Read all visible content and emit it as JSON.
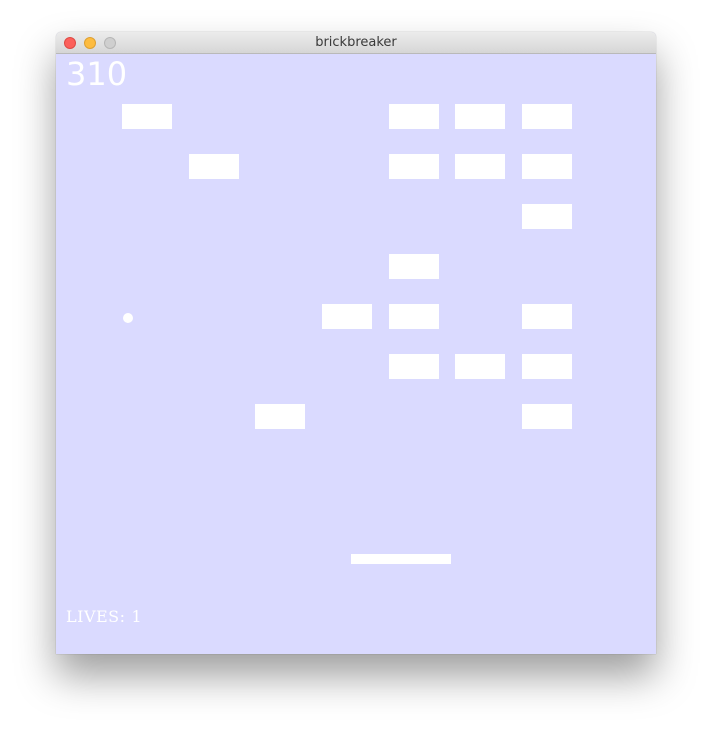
{
  "window": {
    "title": "brickbreaker"
  },
  "hud": {
    "score": "310",
    "lives_label": "LIVES:",
    "lives_value": "1"
  },
  "colors": {
    "playfield_background": "#dadaff",
    "brick": "#ffffff",
    "ball": "#ffffff",
    "paddle": "#ffffff",
    "hud_text": "#ffffff"
  },
  "grid": {
    "columns": 8,
    "rows": 7
  },
  "bricks": [
    {
      "row": 0,
      "col": 0
    },
    {
      "row": 0,
      "col": 4
    },
    {
      "row": 0,
      "col": 5
    },
    {
      "row": 0,
      "col": 6
    },
    {
      "row": 1,
      "col": 1
    },
    {
      "row": 1,
      "col": 4
    },
    {
      "row": 1,
      "col": 5
    },
    {
      "row": 1,
      "col": 6
    },
    {
      "row": 2,
      "col": 6
    },
    {
      "row": 3,
      "col": 4
    },
    {
      "row": 4,
      "col": 3
    },
    {
      "row": 4,
      "col": 4
    },
    {
      "row": 4,
      "col": 6
    },
    {
      "row": 5,
      "col": 4
    },
    {
      "row": 5,
      "col": 5
    },
    {
      "row": 5,
      "col": 6
    },
    {
      "row": 6,
      "col": 2
    },
    {
      "row": 6,
      "col": 6
    }
  ]
}
